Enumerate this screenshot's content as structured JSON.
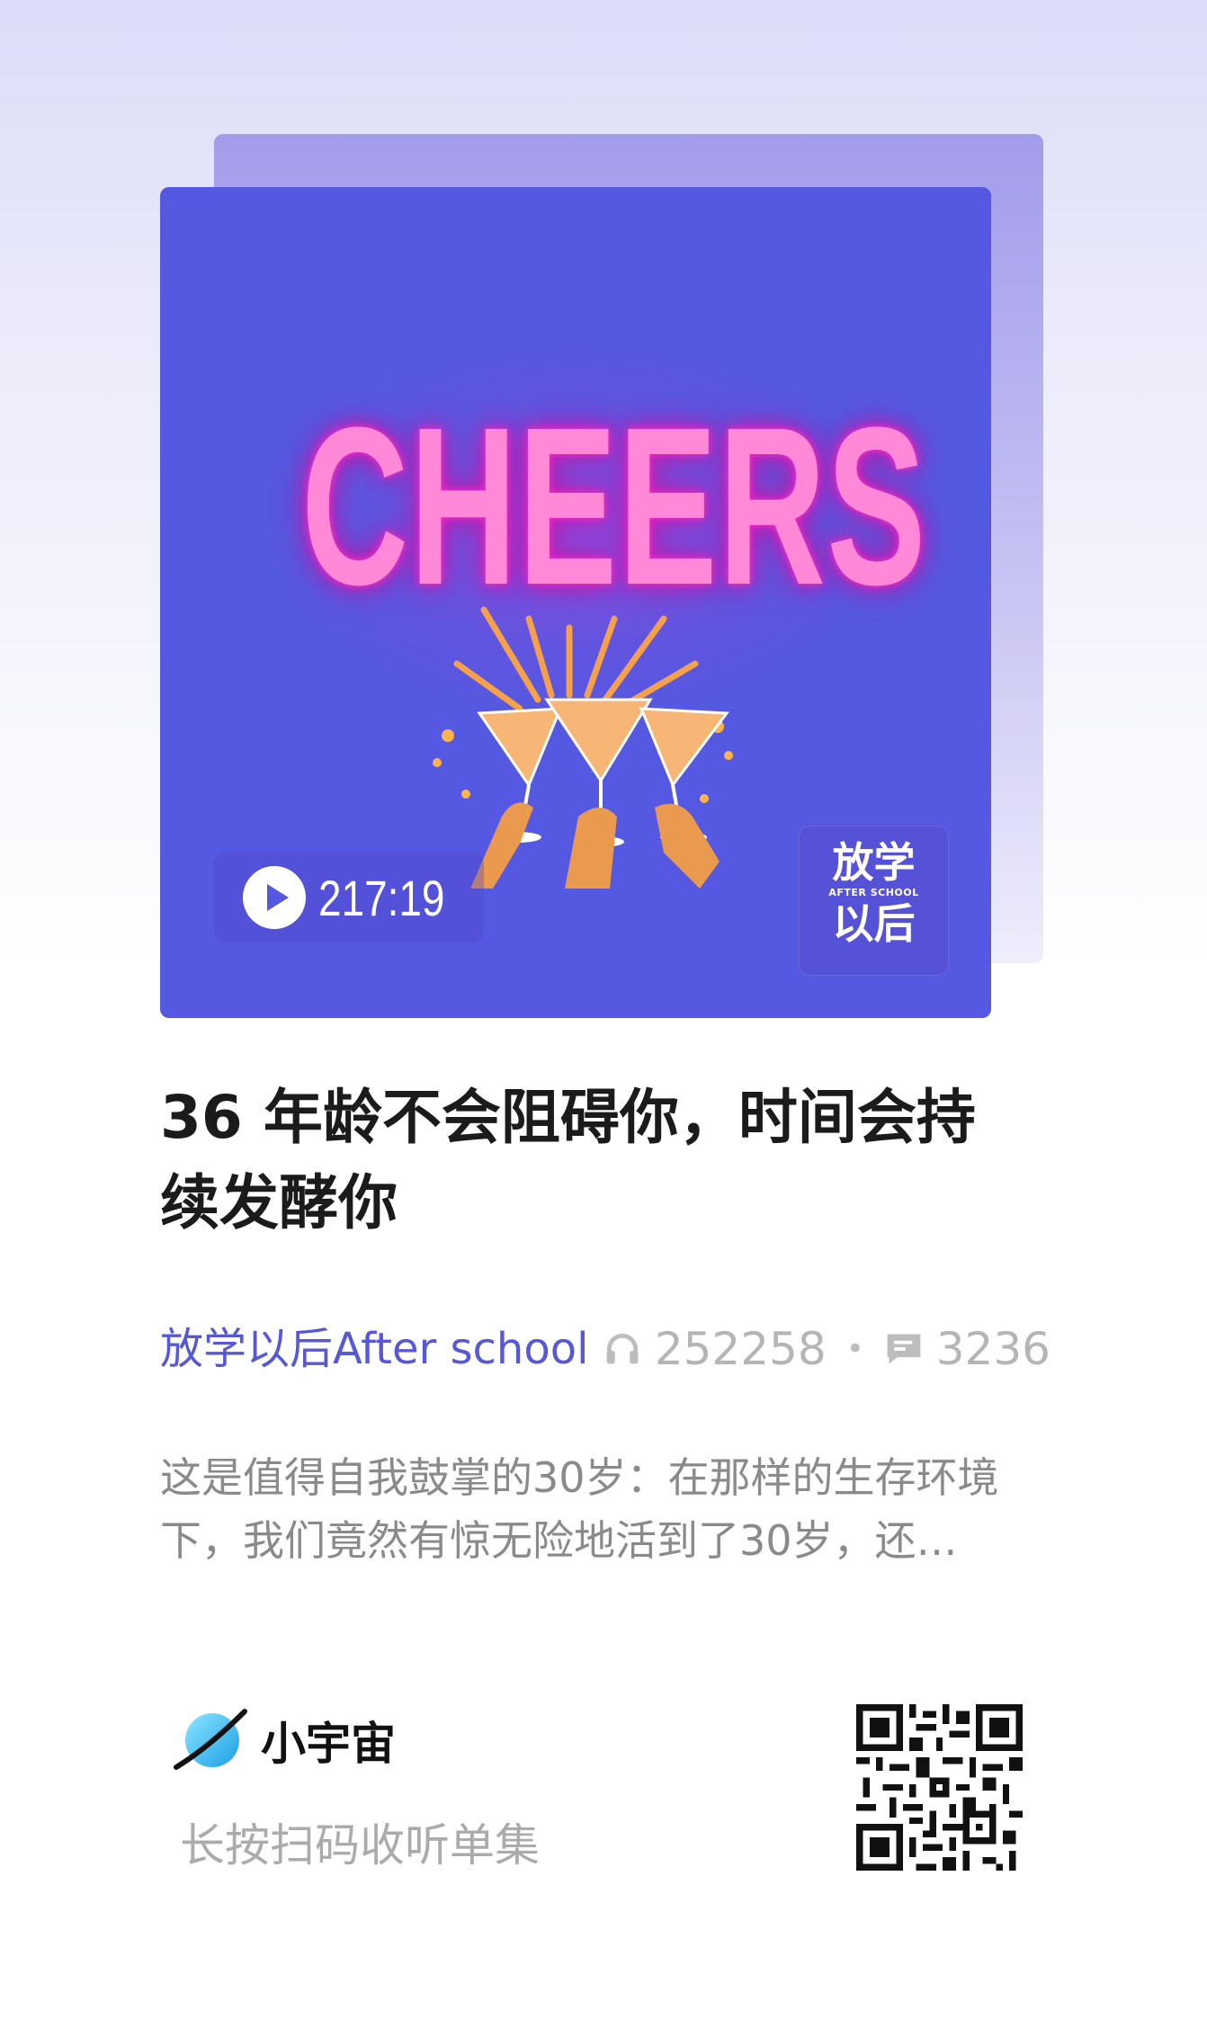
{
  "cover": {
    "title_art": "CHEERS",
    "duration": "217:19",
    "show_logo": {
      "line1": "放学",
      "line2": "AFTER SCHOOL",
      "line3": "以后"
    }
  },
  "episode": {
    "title": "36 年龄不会阻碍你，时间会持续发酵你",
    "podcast": "放学以后After school",
    "plays": "252258",
    "separator": "•",
    "comments": "3236",
    "description": "这是值得自我鼓掌的30岁：在那样的生存环境下，我们竟然有惊无险地活到了30岁，还…"
  },
  "footer": {
    "brand": "小宇宙",
    "scan_hint": "长按扫码收听单集"
  },
  "icons": {
    "play": "play-icon",
    "plays": "headphones-icon",
    "comments": "comment-icon",
    "brand": "planet-logo-icon",
    "qr": "qr-code"
  },
  "colors": {
    "cover_bg": "#5558e0",
    "accent": "#5758d6",
    "neon_pink": "#ff88d8",
    "muted_text": "#8a8a8a"
  }
}
